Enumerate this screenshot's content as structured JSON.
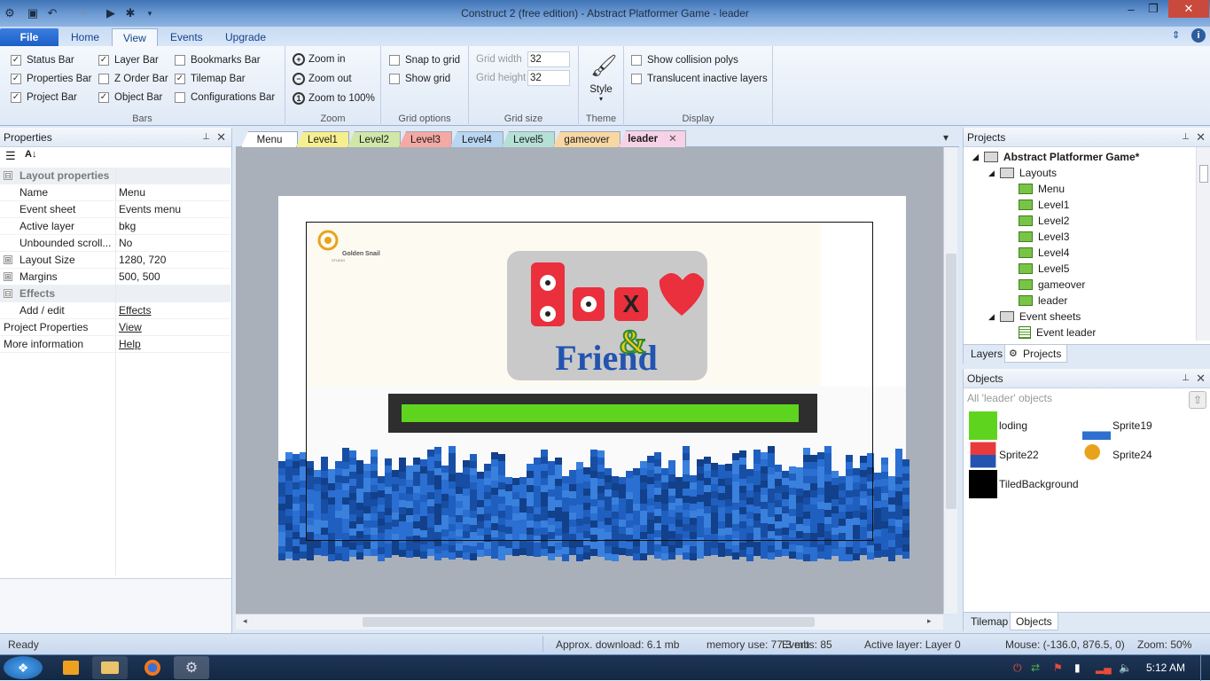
{
  "window": {
    "title": "Construct 2  (free edition) - Abstract Platformer Game - leader",
    "controls": {
      "minimize": "–",
      "maximize": "❐",
      "close": "✕"
    }
  },
  "ribbon_tabs": [
    "File",
    "Home",
    "View",
    "Events",
    "Upgrade"
  ],
  "ribbon_active_tab": "View",
  "bars_group": {
    "label": "Bars",
    "items": [
      {
        "label": "Status Bar",
        "checked": "✓"
      },
      {
        "label": "Properties Bar",
        "checked": "✓"
      },
      {
        "label": "Project Bar",
        "checked": "✓"
      },
      {
        "label": "Layer Bar",
        "checked": "✓"
      },
      {
        "label": "Z Order Bar",
        "checked": ""
      },
      {
        "label": "Object Bar",
        "checked": "✓"
      },
      {
        "label": "Bookmarks Bar",
        "checked": ""
      },
      {
        "label": "Tilemap Bar",
        "checked": "✓"
      },
      {
        "label": "Configurations Bar",
        "checked": ""
      }
    ]
  },
  "zoom_group": {
    "label": "Zoom",
    "zoom_in": "Zoom in",
    "zoom_out": "Zoom out",
    "zoom_100": "Zoom to 100%"
  },
  "grid_options": {
    "label": "Grid options",
    "snap": "Snap to grid",
    "show": "Show grid"
  },
  "grid_size": {
    "label": "Grid size",
    "width_label": "Grid width",
    "width_value": "32",
    "height_label": "Grid height",
    "height_value": "32"
  },
  "theme": {
    "label": "Theme",
    "style": "Style"
  },
  "display": {
    "label": "Display",
    "collision": "Show collision polys",
    "translucent": "Translucent inactive layers"
  },
  "properties_panel": {
    "title": "Properties",
    "rows": [
      {
        "key": "Layout properties",
        "value": "",
        "type": "cat",
        "exp": "⊟"
      },
      {
        "key": "Name",
        "value": "Menu"
      },
      {
        "key": "Event sheet",
        "value": "Events menu"
      },
      {
        "key": "Active layer",
        "value": "bkg"
      },
      {
        "key": "Unbounded scroll...",
        "value": "No"
      },
      {
        "key": "Layout Size",
        "value": "1280, 720",
        "exp": "⊞"
      },
      {
        "key": "Margins",
        "value": "500, 500",
        "exp": "⊞"
      },
      {
        "key": "Effects",
        "value": "",
        "type": "cat",
        "exp": "⊟"
      },
      {
        "key": "Add / edit",
        "value": "Effects",
        "link": true
      },
      {
        "key": "Project Properties",
        "value": "View",
        "link": true,
        "root": true
      },
      {
        "key": "More information",
        "value": "Help",
        "link": true,
        "root": true
      }
    ]
  },
  "doc_tabs": [
    {
      "label": "Menu",
      "color": "#ffffff"
    },
    {
      "label": "Level1",
      "color": "#f6ef8f"
    },
    {
      "label": "Level2",
      "color": "#cfe7a8"
    },
    {
      "label": "Level3",
      "color": "#f4a9a4"
    },
    {
      "label": "Level4",
      "color": "#b9d6f2"
    },
    {
      "label": "Level5",
      "color": "#b6e0d6"
    },
    {
      "label": "gameover",
      "color": "#f8d7a3"
    },
    {
      "label": "leader",
      "color": "#f7d2e6"
    }
  ],
  "doc_tab_close": "✕",
  "canvas": {
    "logo_top": "Golden Snail",
    "logo_sub": "STUDIO",
    "title_letters": [
      "B",
      "O",
      "X",
      "Y"
    ],
    "amp": "&",
    "word": "Friend",
    "progress": 1.0,
    "colors": {
      "progress_fill": "#5fd41f",
      "progress_track": "#2e2e2e",
      "water": "#1f5fbf"
    }
  },
  "projects_panel": {
    "title": "Projects",
    "root": "Abstract Platformer Game*",
    "layouts_folder": "Layouts",
    "layouts": [
      "Menu",
      "Level1",
      "Level2",
      "Level3",
      "Level4",
      "Level5",
      "gameover",
      "leader"
    ],
    "events_folder": "Event sheets",
    "events": [
      "Event leader"
    ],
    "bottom_tabs": [
      "Layers",
      "Projects"
    ]
  },
  "objects_panel": {
    "title": "Objects",
    "filter": "All 'leader' objects",
    "items": [
      {
        "name": "loding"
      },
      {
        "name": "Sprite19"
      },
      {
        "name": "Sprite22"
      },
      {
        "name": "Sprite24"
      },
      {
        "name": "TiledBackground"
      }
    ],
    "bottom_tabs": [
      "Tilemap",
      "Objects"
    ]
  },
  "status": {
    "ready": "Ready",
    "download": "Approx. download: 6.1 mb",
    "memory": "memory use: 77.3 mb",
    "events": "Events: 85",
    "layer": "Active layer: Layer 0",
    "mouse": "Mouse: (-136.0, 876.5, 0)",
    "zoom": "Zoom: 50%"
  },
  "taskbar": {
    "time": "5:12 AM"
  }
}
